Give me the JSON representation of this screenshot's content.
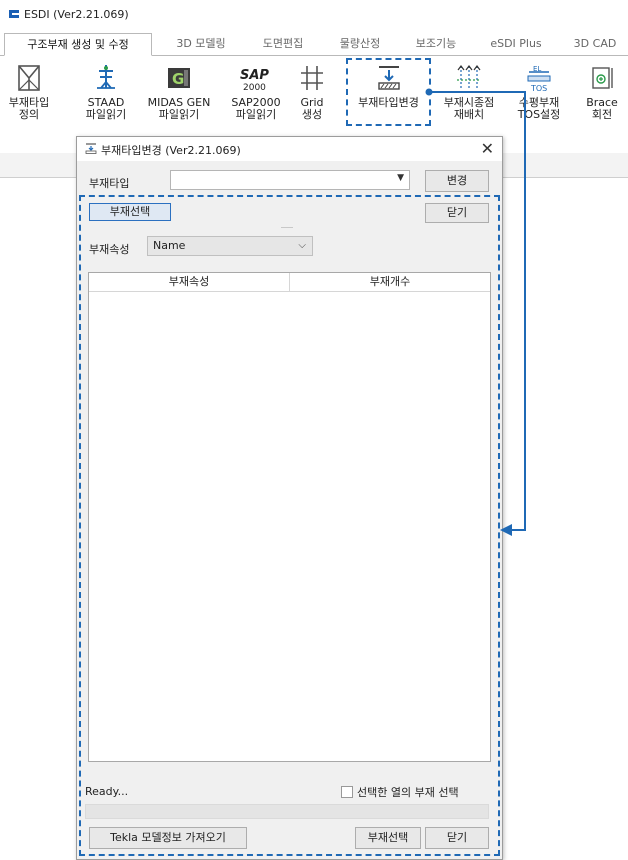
{
  "app": {
    "title": "ESDI (Ver2.21.069)"
  },
  "ribbon_tabs": [
    {
      "label": "구조부재 생성 및 수정",
      "active": true
    },
    {
      "label": "3D 모델링"
    },
    {
      "label": "도면편집"
    },
    {
      "label": "물량산정"
    },
    {
      "label": "보조기능"
    },
    {
      "label": "eSDI Plus"
    },
    {
      "label": "3D CAD"
    }
  ],
  "ribbon_buttons": [
    {
      "label": "부재타입\n정의",
      "icon": "member-type-define-icon"
    },
    {
      "label": "STAAD\n파일읽기",
      "icon": "staad-icon"
    },
    {
      "label": "MIDAS GEN\n파일읽기",
      "icon": "midas-gen-icon"
    },
    {
      "label": "SAP2000\n파일읽기",
      "icon": "sap2000-icon"
    },
    {
      "label": "Grid\n생성",
      "icon": "grid-icon"
    },
    {
      "label": "부재타입변경",
      "icon": "member-type-change-icon"
    },
    {
      "label": "부재시종점\n재배치",
      "icon": "member-endpoint-icon"
    },
    {
      "label": "수평부재\nTOS설정",
      "icon": "tos-icon"
    },
    {
      "label": "Brace\n회전",
      "icon": "brace-rotate-icon"
    }
  ],
  "dialog": {
    "title": "부재타입변경 (Ver2.21.069)",
    "close_glyph": "✕",
    "member_type_label": "부재타입",
    "member_type_value": "",
    "change_button": "변경",
    "select_member_button": "부재선택",
    "close_button": "닫기",
    "property_label": "부재속성",
    "property_value": "Name",
    "grid_headers": [
      "부재속성",
      "부재개수"
    ],
    "status": "Ready...",
    "checkbox_label": "선택한 열의 부재 선택",
    "checkbox_checked": false,
    "tekla_button": "Tekla 모델정보 가져오기",
    "select_member_button_bottom": "부재선택",
    "close_button_bottom": "닫기"
  },
  "colors": {
    "accent": "#1f69b5",
    "logo": "#1a5fb4"
  }
}
